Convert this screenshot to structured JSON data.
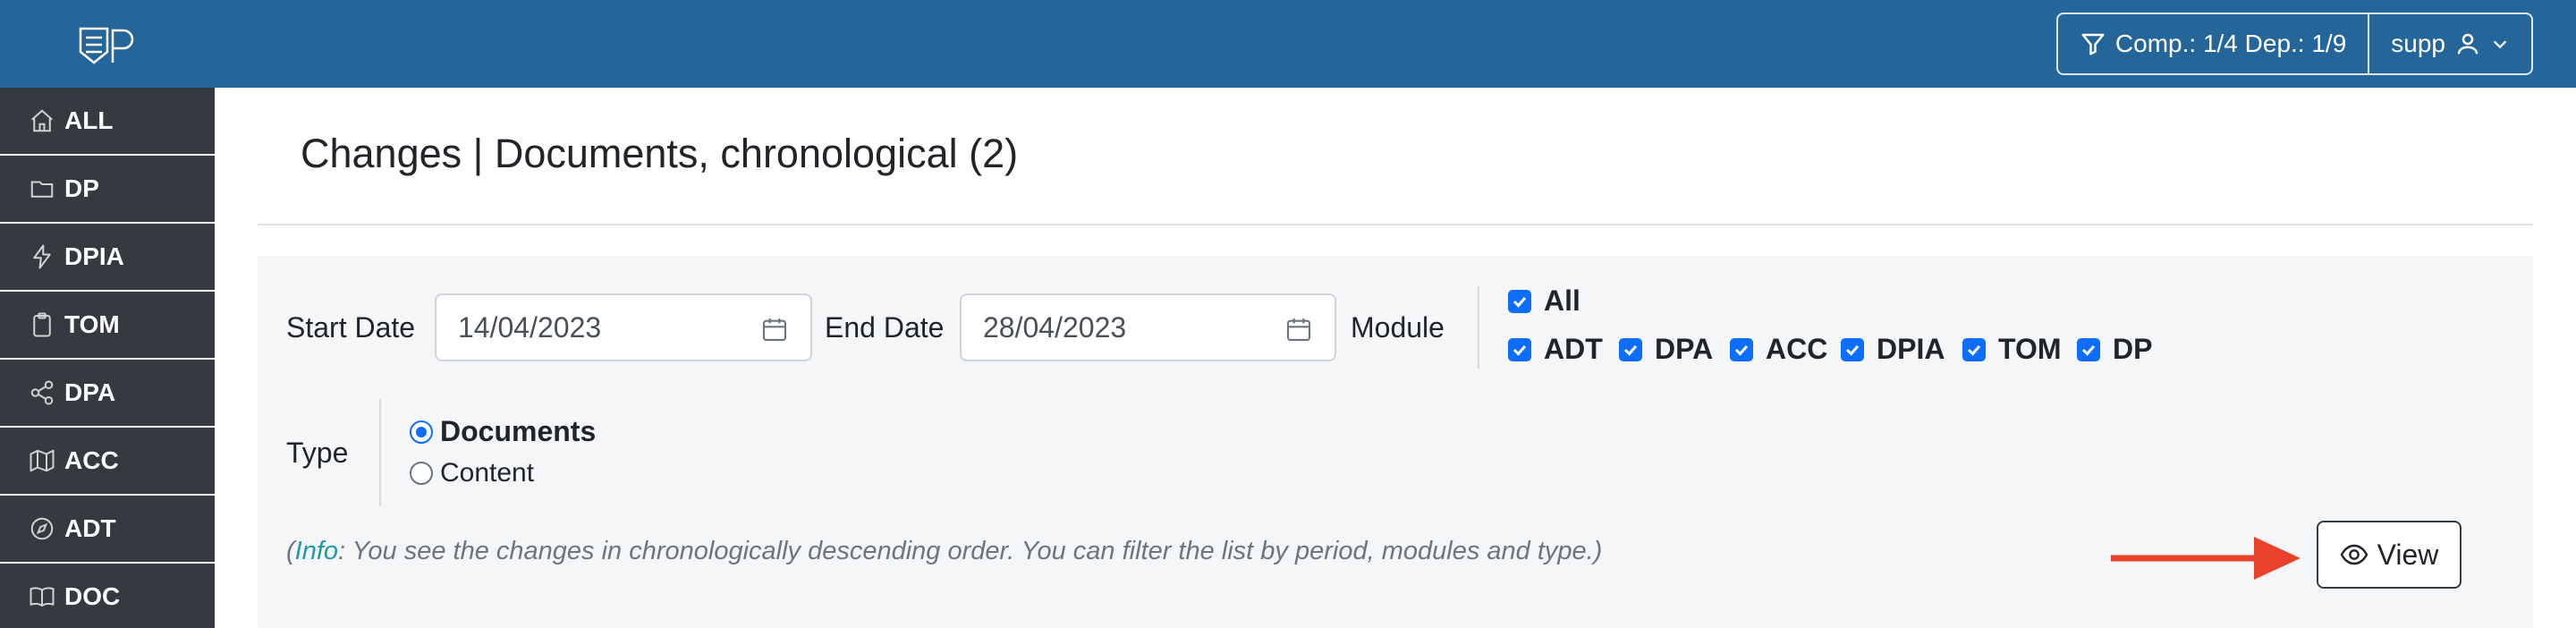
{
  "header": {
    "filter_label": "Comp.: 1/4 Dep.: 1/9",
    "user_label": "supp",
    "brand_color": "#25669a"
  },
  "sidebar": {
    "items": [
      {
        "label": "ALL",
        "icon": "home-icon"
      },
      {
        "label": "DP",
        "icon": "folder-icon"
      },
      {
        "label": "DPIA",
        "icon": "lightning-icon"
      },
      {
        "label": "TOM",
        "icon": "clipboard-icon"
      },
      {
        "label": "DPA",
        "icon": "share-icon"
      },
      {
        "label": "ACC",
        "icon": "map-icon"
      },
      {
        "label": "ADT",
        "icon": "compass-icon"
      },
      {
        "label": "DOC",
        "icon": "book-icon"
      }
    ]
  },
  "main": {
    "title": "Changes | Documents, chronological (2)"
  },
  "filters": {
    "start_date_label": "Start Date",
    "start_date_value": "14/04/2023",
    "end_date_label": "End Date",
    "end_date_value": "28/04/2023",
    "module_label": "Module",
    "modules_all": {
      "label": "All",
      "checked": true
    },
    "modules": [
      {
        "label": "ADT",
        "checked": true
      },
      {
        "label": "DPA",
        "checked": true
      },
      {
        "label": "ACC",
        "checked": true
      },
      {
        "label": "DPIA",
        "checked": true
      },
      {
        "label": "TOM",
        "checked": true
      },
      {
        "label": "DP",
        "checked": true
      }
    ],
    "type_label": "Type",
    "type_options": [
      {
        "label": "Documents",
        "selected": true
      },
      {
        "label": "Content",
        "selected": false
      }
    ],
    "info_key": "Info",
    "info_text": ": You see the changes in chronologically descending order. You can filter the list by period, modules and type.)",
    "info_open": "(",
    "view_label": "View"
  }
}
